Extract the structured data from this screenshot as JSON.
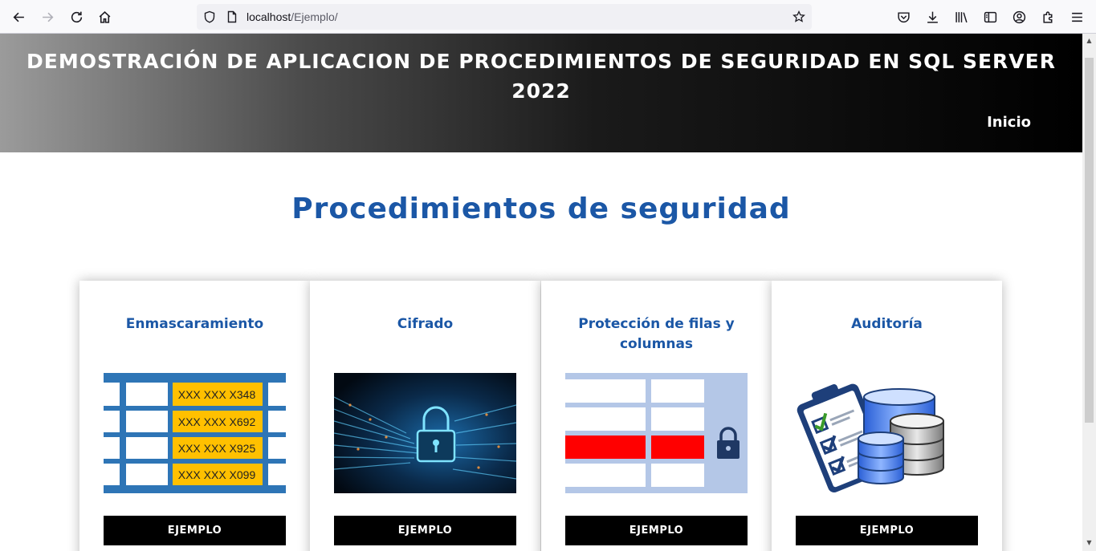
{
  "browser": {
    "url_host": "localhost",
    "url_path": "/Ejemplo/"
  },
  "header": {
    "title": "DEMOSTRACIÓN DE APLICACION DE PROCEDIMIENTOS DE SEGURIDAD EN SQL SERVER 2022",
    "nav_inicio": "Inicio"
  },
  "main": {
    "section_title": "Procedimientos de seguridad",
    "cards": [
      {
        "title": "Enmascaramiento",
        "button": "EJEMPLO",
        "mask_rows": [
          "XXX XXX X348",
          "XXX XXX X692",
          "XXX XXX X925",
          "XXX XXX X099"
        ]
      },
      {
        "title": "Cifrado",
        "button": "EJEMPLO"
      },
      {
        "title": "Protección de filas y columnas",
        "button": "EJEMPLO"
      },
      {
        "title": "Auditoría",
        "button": "EJEMPLO"
      }
    ]
  },
  "colors": {
    "title_blue": "#1b57a6",
    "mask_blue": "#2e75b6",
    "mask_yellow": "#ffc000",
    "rls_blue": "#b4c7e7",
    "rls_red": "#ff0000"
  }
}
